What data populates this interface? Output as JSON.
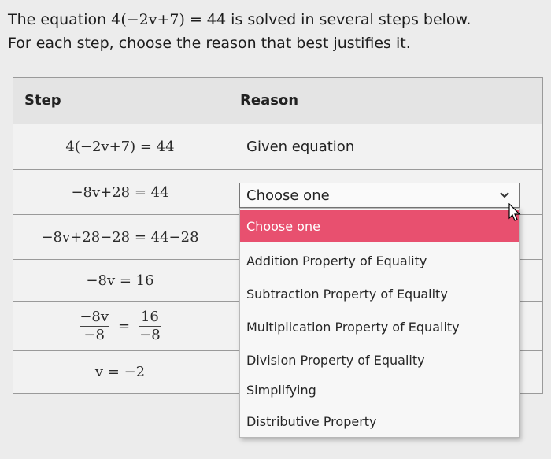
{
  "prompt": {
    "line1_pre": "The equation ",
    "line1_math": "4(−2v+7) = 44",
    "line1_post": " is solved in several steps below.",
    "line2": "For each step, choose the reason that best justifies it."
  },
  "table": {
    "header_step": "Step",
    "header_reason": "Reason",
    "rows": [
      {
        "step": "4(−2v+7) = 44",
        "reason": "Given equation"
      },
      {
        "step": "−8v+28 = 44",
        "reason": ""
      },
      {
        "step": "−8v+28−28 = 44−28",
        "reason": ""
      },
      {
        "step": "−8v = 16",
        "reason": ""
      },
      {
        "step_frac": {
          "left_num": "−8v",
          "left_den": "−8",
          "eq": "=",
          "right_num": "16",
          "right_den": "−8"
        },
        "reason": ""
      },
      {
        "step": "v = −2",
        "reason": ""
      }
    ]
  },
  "select": {
    "value": "Choose one",
    "chevron_icon": "chevron-down-icon"
  },
  "dropdown": {
    "options": [
      "Choose one",
      "Addition Property of Equality",
      "Subtraction Property of Equality",
      "Multiplication Property of Equality",
      "Division Property of Equality",
      "Simplifying",
      "Distributive Property"
    ],
    "selected_index": 0,
    "highlight_color": "#e8506f"
  }
}
